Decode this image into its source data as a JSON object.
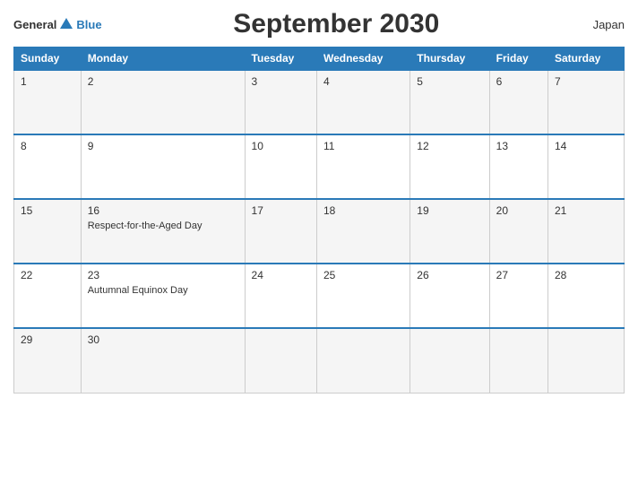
{
  "header": {
    "logo_general": "General",
    "logo_blue": "Blue",
    "title": "September 2030",
    "country": "Japan"
  },
  "weekdays": [
    "Sunday",
    "Monday",
    "Tuesday",
    "Wednesday",
    "Thursday",
    "Friday",
    "Saturday"
  ],
  "weeks": [
    [
      {
        "day": "1",
        "event": ""
      },
      {
        "day": "2",
        "event": ""
      },
      {
        "day": "3",
        "event": ""
      },
      {
        "day": "4",
        "event": ""
      },
      {
        "day": "5",
        "event": ""
      },
      {
        "day": "6",
        "event": ""
      },
      {
        "day": "7",
        "event": ""
      }
    ],
    [
      {
        "day": "8",
        "event": ""
      },
      {
        "day": "9",
        "event": ""
      },
      {
        "day": "10",
        "event": ""
      },
      {
        "day": "11",
        "event": ""
      },
      {
        "day": "12",
        "event": ""
      },
      {
        "day": "13",
        "event": ""
      },
      {
        "day": "14",
        "event": ""
      }
    ],
    [
      {
        "day": "15",
        "event": ""
      },
      {
        "day": "16",
        "event": "Respect-for-the-Aged Day"
      },
      {
        "day": "17",
        "event": ""
      },
      {
        "day": "18",
        "event": ""
      },
      {
        "day": "19",
        "event": ""
      },
      {
        "day": "20",
        "event": ""
      },
      {
        "day": "21",
        "event": ""
      }
    ],
    [
      {
        "day": "22",
        "event": ""
      },
      {
        "day": "23",
        "event": "Autumnal Equinox Day"
      },
      {
        "day": "24",
        "event": ""
      },
      {
        "day": "25",
        "event": ""
      },
      {
        "day": "26",
        "event": ""
      },
      {
        "day": "27",
        "event": ""
      },
      {
        "day": "28",
        "event": ""
      }
    ],
    [
      {
        "day": "29",
        "event": ""
      },
      {
        "day": "30",
        "event": ""
      },
      {
        "day": "",
        "event": ""
      },
      {
        "day": "",
        "event": ""
      },
      {
        "day": "",
        "event": ""
      },
      {
        "day": "",
        "event": ""
      },
      {
        "day": "",
        "event": ""
      }
    ]
  ]
}
